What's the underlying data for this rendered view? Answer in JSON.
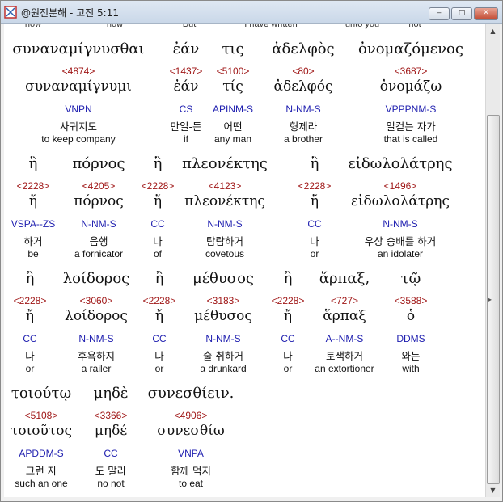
{
  "window": {
    "title": "@원전분해 - 고전 5:11",
    "buttons": {
      "minimize": "‒",
      "maximize": "□",
      "close": "✕"
    }
  },
  "partial_row": [
    "now",
    "now",
    "But",
    "I have written",
    "unto you",
    "not"
  ],
  "rows": [
    {
      "words": [
        {
          "greek": "συναναμίγνυσθαι",
          "strong": "<4874>",
          "lemma": "συναναμίγνυμι",
          "morph": "VNPN",
          "korean": "사귀지도",
          "english": "to keep company"
        },
        {
          "greek": "ἐάν",
          "strong": "<1437>",
          "lemma": "ἐάν",
          "morph": "CS",
          "korean": "만일-든",
          "english": "if"
        },
        {
          "greek": "τις",
          "strong": "<5100>",
          "lemma": "τίς",
          "morph": "APINM-S",
          "korean": "어떤",
          "english": "any man"
        },
        {
          "greek": "ἀδελφὸς",
          "strong": "<80>",
          "lemma": "ἀδελφός",
          "morph": "N-NM-S",
          "korean": "형제라",
          "english": "a brother"
        },
        {
          "greek": "ὀνομαζόμενος",
          "strong": "<3687>",
          "lemma": "ὀνομάζω",
          "morph": "VPPPNM-S",
          "korean": "일컫는 자가",
          "english": "that is called"
        }
      ]
    },
    {
      "words": [
        {
          "greek": "ἢ",
          "strong": "<2228>",
          "lemma": "ἤ",
          "morph": "VSPA--ZS",
          "korean": "하거",
          "english": "be"
        },
        {
          "greek": "πόρνος",
          "strong": "<4205>",
          "lemma": "πόρνος",
          "morph": "N-NM-S",
          "korean": "음행",
          "english": "a fornicator"
        },
        {
          "greek": "ἢ",
          "strong": "<2228>",
          "lemma": "ἤ",
          "morph": "CC",
          "korean": "나",
          "english": "of"
        },
        {
          "greek": "πλεονέκτης",
          "strong": "<4123>",
          "lemma": "πλεονέκτης",
          "morph": "N-NM-S",
          "korean": "탐람하거",
          "english": "covetous"
        },
        {
          "greek": "ἢ",
          "strong": "<2228>",
          "lemma": "ἤ",
          "morph": "CC",
          "korean": "나",
          "english": "or"
        },
        {
          "greek": "εἰδωλολάτρης",
          "strong": "<1496>",
          "lemma": "εἰδωλολάτρης",
          "morph": "N-NM-S",
          "korean": "우상 숭배를 하거",
          "english": "an idolater"
        }
      ]
    },
    {
      "words": [
        {
          "greek": "ἢ",
          "strong": "<2228>",
          "lemma": "ἤ",
          "morph": "CC",
          "korean": "나",
          "english": "or"
        },
        {
          "greek": "λοίδορος",
          "strong": "<3060>",
          "lemma": "λοίδορος",
          "morph": "N-NM-S",
          "korean": "후욕하지",
          "english": "a railer"
        },
        {
          "greek": "ἢ",
          "strong": "<2228>",
          "lemma": "ἤ",
          "morph": "CC",
          "korean": "나",
          "english": "or"
        },
        {
          "greek": "μέθυσος",
          "strong": "<3183>",
          "lemma": "μέθυσος",
          "morph": "N-NM-S",
          "korean": "술 취하거",
          "english": "a drunkard"
        },
        {
          "greek": "ἢ",
          "strong": "<2228>",
          "lemma": "ἤ",
          "morph": "CC",
          "korean": "나",
          "english": "or"
        },
        {
          "greek": "ἅρπαξ,",
          "strong": "<727>",
          "lemma": "ἅρπαξ",
          "morph": "A--NM-S",
          "korean": "토색하거",
          "english": "an extortioner"
        },
        {
          "greek": "τῷ",
          "strong": "<3588>",
          "lemma": "ὁ",
          "morph": "DDMS",
          "korean": "와는",
          "english": "with"
        }
      ]
    },
    {
      "words": [
        {
          "greek": "τοιούτῳ",
          "strong": "<5108>",
          "lemma": "τοιοῦτος",
          "morph": "APDDM-S",
          "korean": "그런 자",
          "english": "such an one"
        },
        {
          "greek": "μηδὲ",
          "strong": "<3366>",
          "lemma": "μηδέ",
          "morph": "CC",
          "korean": "도 말라",
          "english": "no not"
        },
        {
          "greek": "συνεσθίειν.",
          "strong": "<4906>",
          "lemma": "συνεσθίω",
          "morph": "VNPA",
          "korean": "함께 먹지",
          "english": "to eat"
        }
      ]
    }
  ]
}
